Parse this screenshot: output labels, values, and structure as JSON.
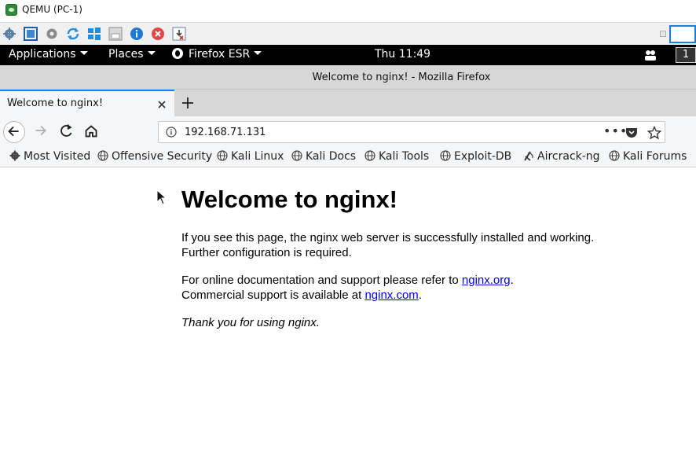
{
  "qemu": {
    "title": "QEMU (PC-1)",
    "toolbar_icons": [
      "settings-gear-icon",
      "fullscreen-icon",
      "gear-icon",
      "refresh-icon",
      "windows-icon",
      "floppy-icon",
      "info-icon",
      "stop-icon",
      "screenshot-icon"
    ]
  },
  "panel": {
    "applications_label": "Applications",
    "places_label": "Places",
    "firefox_label": "Firefox ESR",
    "clock": "Thu 11:49",
    "workspace": "1"
  },
  "firefox": {
    "window_title": "Welcome to nginx! - Mozilla Firefox",
    "tab_title": "Welcome to nginx!",
    "url": "192.168.71.131",
    "url_menu": "•••",
    "accent_color": "#0a84ff"
  },
  "bookmarks": [
    {
      "label": "Most Visited",
      "icon": "gear-icon"
    },
    {
      "label": "Offensive Security",
      "icon": "globe-icon"
    },
    {
      "label": "Kali Linux",
      "icon": "globe-icon"
    },
    {
      "label": "Kali Docs",
      "icon": "globe-icon"
    },
    {
      "label": "Kali Tools",
      "icon": "globe-icon"
    },
    {
      "label": "Exploit-DB",
      "icon": "globe-icon"
    },
    {
      "label": "Aircrack-ng",
      "icon": "antenna-icon"
    },
    {
      "label": "Kali Forums",
      "icon": "globe-icon"
    }
  ],
  "page": {
    "heading": "Welcome to nginx!",
    "para1_line1": "If you see this page, the nginx web server is successfully installed and working.",
    "para1_line2": "Further configuration is required.",
    "para2_line1_prefix": "For online documentation and support please refer to ",
    "link_org": "nginx.org",
    "para2_line1_suffix": ".",
    "para2_line2_prefix": "Commercial support is available at ",
    "link_com": "nginx.com",
    "para2_line2_suffix": ".",
    "thanks": "Thank you for using nginx.",
    "link_color": "#0000ee"
  }
}
